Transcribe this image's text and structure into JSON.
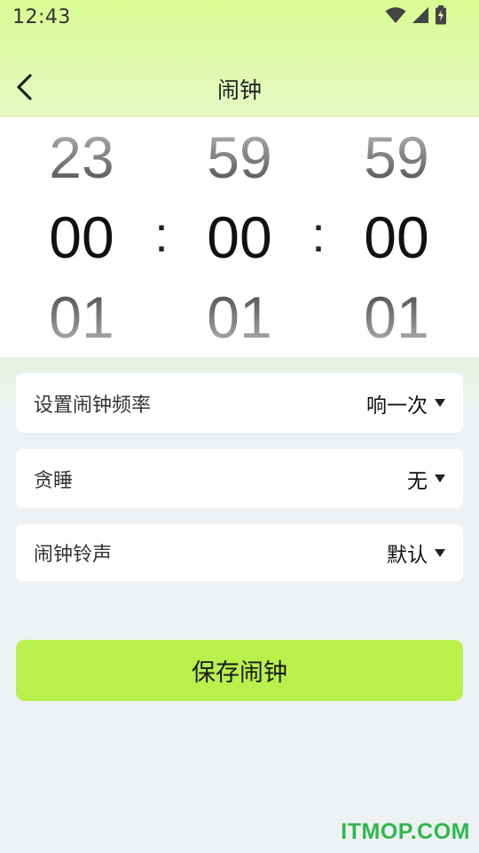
{
  "status_bar": {
    "time": "12:43",
    "icons": [
      "wifi-icon",
      "signal-icon",
      "battery-icon"
    ]
  },
  "app_bar": {
    "back_icon": "back-arrow-icon",
    "title": "闹钟"
  },
  "time_picker": {
    "hours": {
      "prev": "23",
      "current": "00",
      "next": "01"
    },
    "minutes": {
      "prev": "59",
      "current": "00",
      "next": "01"
    },
    "seconds": {
      "prev": "59",
      "current": "00",
      "next": "01"
    },
    "separator": ":"
  },
  "settings": {
    "frequency": {
      "label": "设置闹钟频率",
      "value": "响一次"
    },
    "snooze": {
      "label": "贪睡",
      "value": "无"
    },
    "ringtone": {
      "label": "闹钟铃声",
      "value": "默认"
    }
  },
  "save_button": {
    "label": "保存闹钟"
  },
  "watermark": "ITMOP.COM",
  "colors": {
    "header_green": "#d9fb92",
    "button_green": "#b9f04c",
    "watermark_green": "#2fb84a",
    "page_bg": "#eef1f4"
  }
}
